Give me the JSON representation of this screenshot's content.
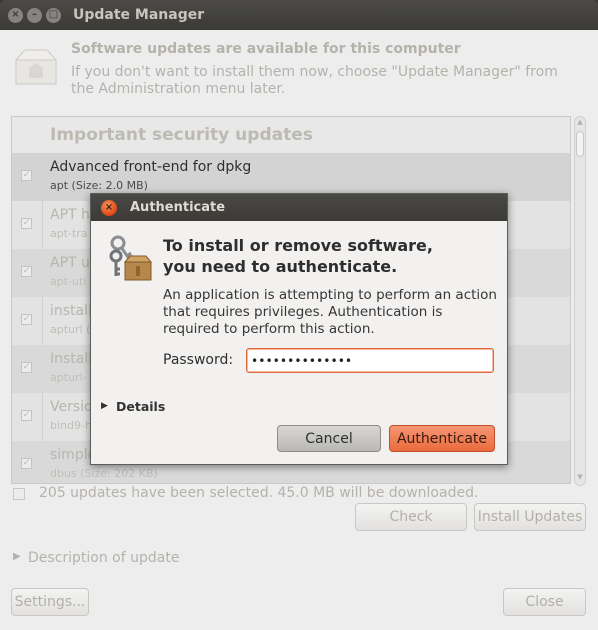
{
  "window": {
    "title": "Update Manager",
    "controls": {
      "close": "×",
      "minimize": "–",
      "maximize": "□"
    }
  },
  "header": {
    "icon": "software-package-icon",
    "title": "Software updates are available for this computer",
    "subtitle": "If you don't want to install them now, choose \"Update Manager\" from the Administration menu later."
  },
  "update_list": {
    "group_label": "Important security updates",
    "items": [
      {
        "name": "Advanced front-end for dpkg",
        "detail": "apt (Size: 2.0 MB)",
        "checked": true,
        "selected": true
      },
      {
        "name": "APT h",
        "detail": "apt-tra",
        "checked": true,
        "selected": false
      },
      {
        "name": "APT u",
        "detail": "apt-uti",
        "checked": true,
        "selected": false
      },
      {
        "name": "install",
        "detail": "apturl (",
        "checked": true,
        "selected": false
      },
      {
        "name": "Install",
        "detail": "apturl-",
        "checked": true,
        "selected": false
      },
      {
        "name": "Versio",
        "detail": "bind9-h",
        "checked": true,
        "selected": false
      },
      {
        "name": "simple",
        "detail": "dbus (Size: 202 KB)",
        "checked": true,
        "selected": false
      }
    ]
  },
  "summary": {
    "text": "205 updates have been selected. 45.0 MB will be downloaded."
  },
  "buttons": {
    "check": "Check",
    "install": "Install Updates",
    "settings": "Settings...",
    "close": "Close"
  },
  "description": {
    "label": "Description of update",
    "arrow": "▶"
  },
  "dialog": {
    "title": "Authenticate",
    "close_glyph": "×",
    "heading_line1": "To install or remove software,",
    "heading_line2": "you need to authenticate.",
    "body": "An application is attempting to perform an action that requires privileges. Authentication is required to perform this action.",
    "password_label": "Password:",
    "password_value": "••••••••••••••",
    "details_label": "Details",
    "details_arrow": "▶",
    "cancel_label": "Cancel",
    "authenticate_label": "Authenticate",
    "accent_color": "#dd4814"
  }
}
